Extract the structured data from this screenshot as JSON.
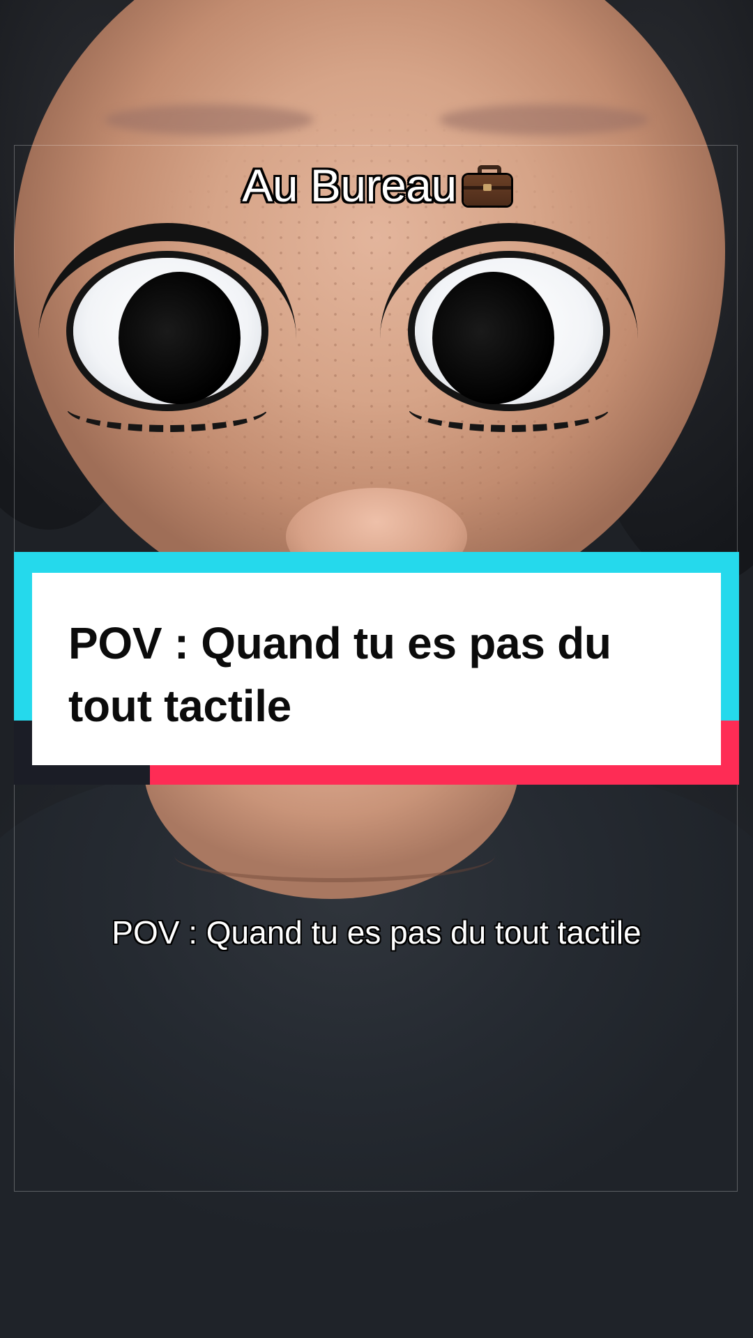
{
  "top_caption": {
    "text": "Au Bureau",
    "icon": "briefcase-icon"
  },
  "title_card": {
    "text": "POV : Quand tu es pas du tout tactile",
    "colors": {
      "cyan": "#25d9ec",
      "pink": "#fe2c55",
      "background": "#ffffff",
      "text": "#0b0b0b"
    }
  },
  "subtitle": {
    "text": "POV : Quand tu es pas du tout tactile"
  }
}
